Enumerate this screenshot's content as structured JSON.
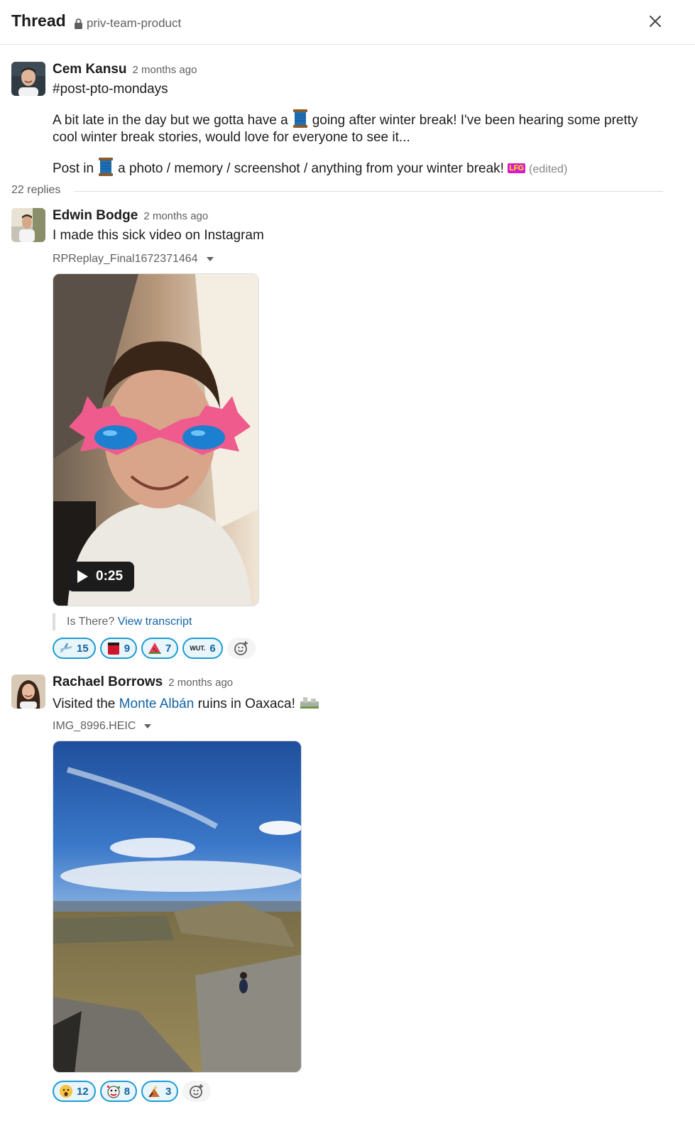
{
  "header": {
    "title": "Thread",
    "channel": "priv-team-product"
  },
  "parent": {
    "author": "Cem Kansu",
    "time": "2 months ago",
    "line1": "#post-pto-mondays",
    "para1_a": "A bit late in the day but we gotta have a",
    "para1_b": "going after winter break! I've been hearing some pretty",
    "para1_c": "cool winter break stories, would love for everyone to see it...",
    "para2_a": "Post in",
    "para2_b": "a photo / memory / screenshot / anything from your winter break!",
    "lfg": "LFG",
    "edited": "(edited)",
    "spool_icon": "spool-emoji"
  },
  "replies_count": "22 replies",
  "reply1": {
    "author": "Edwin Bodge",
    "time": "2 months ago",
    "text": "I made this sick video on Instagram",
    "file_name": "RPReplay_Final1672371464",
    "duration": "0:25",
    "transcript_prefix": "Is There?",
    "transcript_link": "View transcript",
    "reactions": [
      {
        "icon": "airplane-emoji",
        "count": "15"
      },
      {
        "icon": "red-cup-emoji",
        "count": "9"
      },
      {
        "icon": "watermelon-emoji",
        "count": "7"
      },
      {
        "icon": "wut-emoji",
        "count": "6",
        "label": "WUT."
      }
    ]
  },
  "reply2": {
    "author": "Rachael Borrows",
    "time": "2 months ago",
    "text_a": "Visited the",
    "text_link": "Monte Albán",
    "text_b": "ruins in Oaxaca!",
    "file_name": "IMG_8996.HEIC",
    "reactions": [
      {
        "icon": "surprised-face-emoji",
        "count": "12"
      },
      {
        "icon": "party-face-emoji",
        "count": "8"
      },
      {
        "icon": "hiking-emoji",
        "count": "3"
      }
    ]
  },
  "colors": {
    "accent": "#1264a3",
    "reaction_border": "#1d9bd1",
    "reaction_bg": "#e8f5fa"
  }
}
